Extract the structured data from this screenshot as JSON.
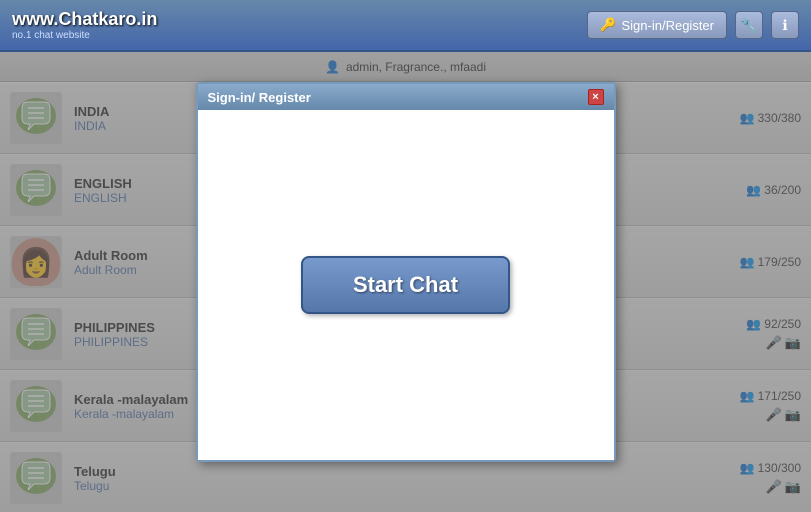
{
  "header": {
    "logo_main": "www.Chatkaro.in",
    "logo_sub": "no.1 chat website",
    "signin_label": "Sign-in/Register",
    "key_icon": "🔑",
    "wrench_icon": "🔧",
    "info_icon": "ℹ"
  },
  "topbar": {
    "user_icon": "👤",
    "users_text": "admin, Fragrance., mfaadi"
  },
  "rooms": [
    {
      "id": "india",
      "name": "INDIA",
      "subname": "INDIA",
      "count": "330/380",
      "has_sub_icons": false,
      "is_adult": false
    },
    {
      "id": "english",
      "name": "ENGLISH",
      "subname": "ENGLISH",
      "count": "36/200",
      "has_sub_icons": false,
      "is_adult": false
    },
    {
      "id": "adult",
      "name": "Adult Room",
      "subname": "Adult Room",
      "count": "179/250",
      "has_sub_icons": false,
      "is_adult": true
    },
    {
      "id": "philippines",
      "name": "PHILIPPINES",
      "subname": "PHILIPPINES",
      "count": "92/250",
      "has_sub_icons": true,
      "is_adult": false
    },
    {
      "id": "kerala",
      "name": "Kerala -malayalam",
      "subname": "Kerala -malayalam",
      "count": "171/250",
      "has_sub_icons": true,
      "is_adult": false
    },
    {
      "id": "telugu",
      "name": "Telugu",
      "subname": "Telugu",
      "count": "130/300",
      "has_sub_icons": true,
      "is_adult": false
    }
  ],
  "modal": {
    "title": "Sign-in/ Register",
    "close_label": "×",
    "start_chat_label": "Start Chat"
  },
  "colors": {
    "accent": "#6688aa",
    "link": "#5577aa",
    "header_bg": "#4466aa"
  }
}
